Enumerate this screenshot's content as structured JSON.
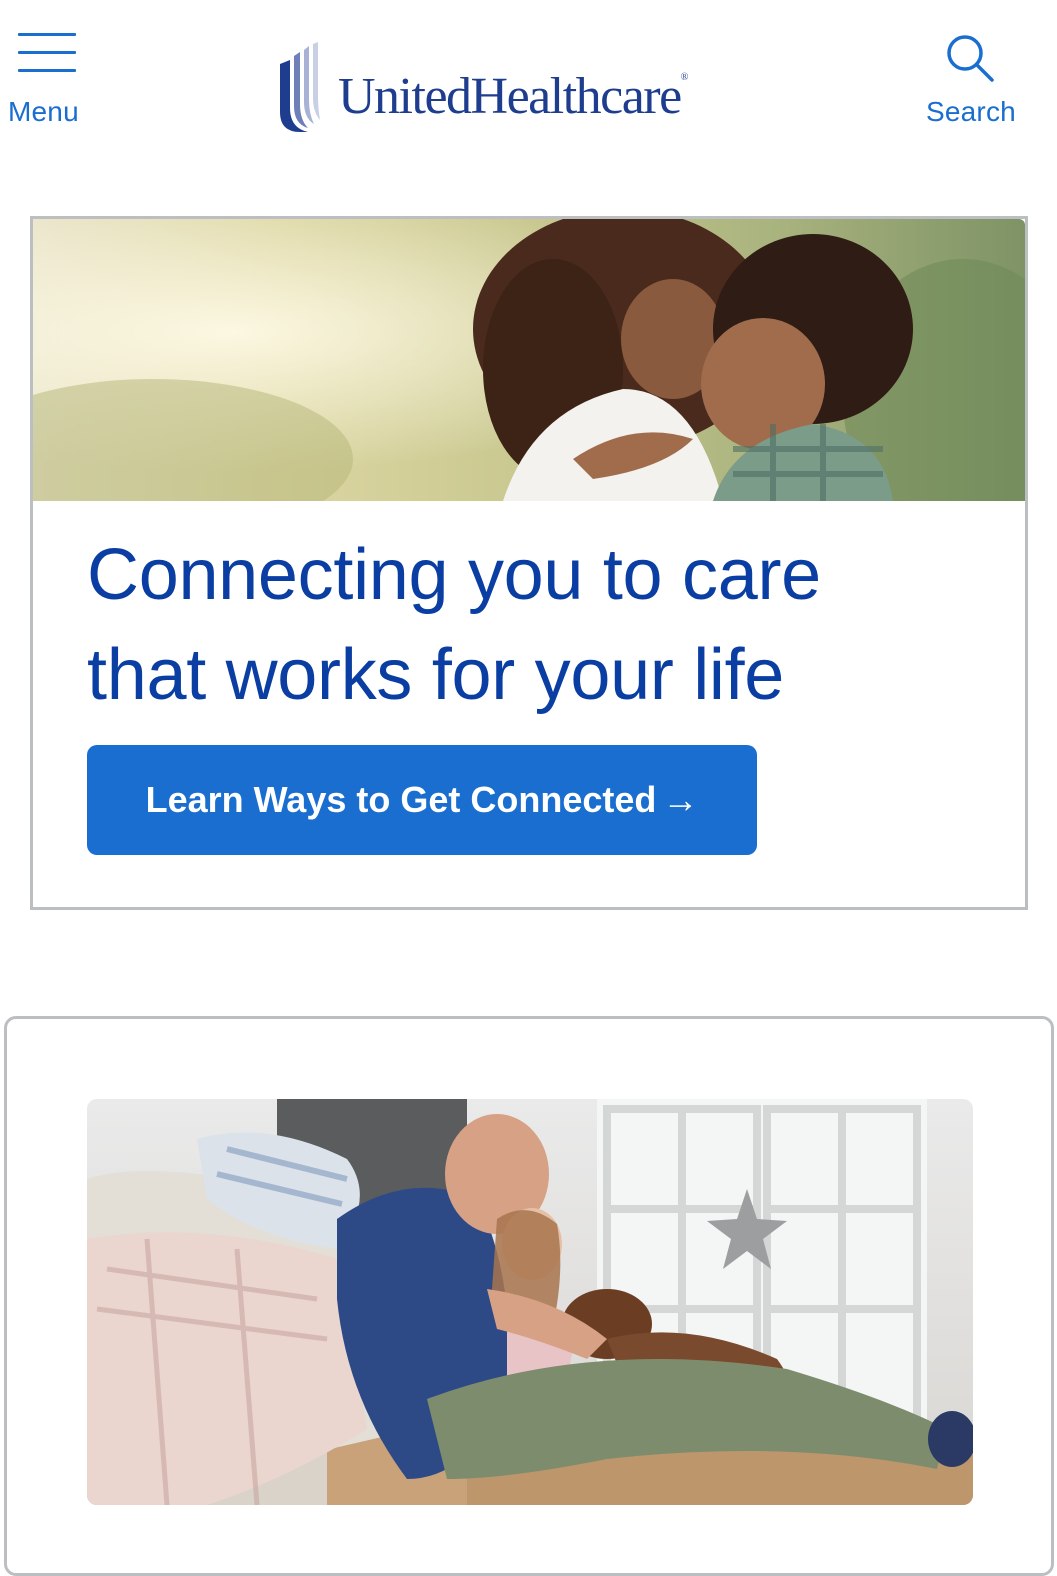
{
  "header": {
    "menu_label": "Menu",
    "logo_text": "UnitedHealthcare",
    "logo_registered": "®",
    "search_label": "Search"
  },
  "icons": {
    "menu": "hamburger-icon",
    "search": "search-icon",
    "logo_mark": "u-logo-mark-icon",
    "cta_arrow": "arrow-right-icon"
  },
  "hero": {
    "title_line1": "Connecting you to care",
    "title_line2": "that works for your life",
    "cta_label": "Learn Ways to Get Connected",
    "cta_arrow": "→"
  },
  "colors": {
    "brand_blue": "#196ECF",
    "title_navy": "#0A3EA3",
    "logo_navy": "#1E3D8F",
    "border_gray": "#BBBFC2"
  }
}
